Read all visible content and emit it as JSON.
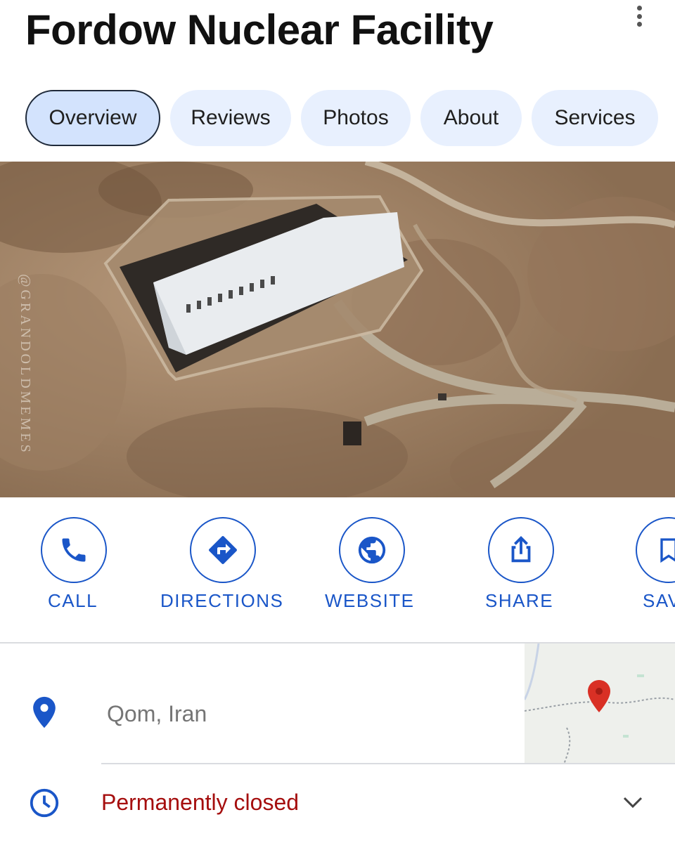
{
  "place": {
    "title": "Fordow Nuclear Facility"
  },
  "menu": {
    "icon": "more-vert-icon"
  },
  "tabs": [
    {
      "label": "Overview",
      "active": true
    },
    {
      "label": "Reviews",
      "active": false
    },
    {
      "label": "Photos",
      "active": false
    },
    {
      "label": "About",
      "active": false
    },
    {
      "label": "Services",
      "active": false
    }
  ],
  "photo": {
    "description_watermark": "@GRANDOLDMEMES"
  },
  "actions": [
    {
      "label": "CALL",
      "icon": "phone-icon"
    },
    {
      "label": "DIRECTIONS",
      "icon": "directions-icon"
    },
    {
      "label": "WEBSITE",
      "icon": "globe-icon"
    },
    {
      "label": "SHARE",
      "icon": "share-icon"
    },
    {
      "label": "SAV",
      "icon": "bookmark-icon"
    }
  ],
  "details": {
    "address": "Qom, Iran",
    "address_icon": "location-pin-icon",
    "hours": "Permanently closed",
    "hours_icon": "clock-icon",
    "expand_icon": "chevron-down-icon"
  },
  "colors": {
    "accent": "#1a56c8",
    "tab_bg": "#e8f0fe",
    "tab_active_bg": "#d3e3fd",
    "closed_red": "#a50e0e",
    "pin_red": "#d93025"
  }
}
